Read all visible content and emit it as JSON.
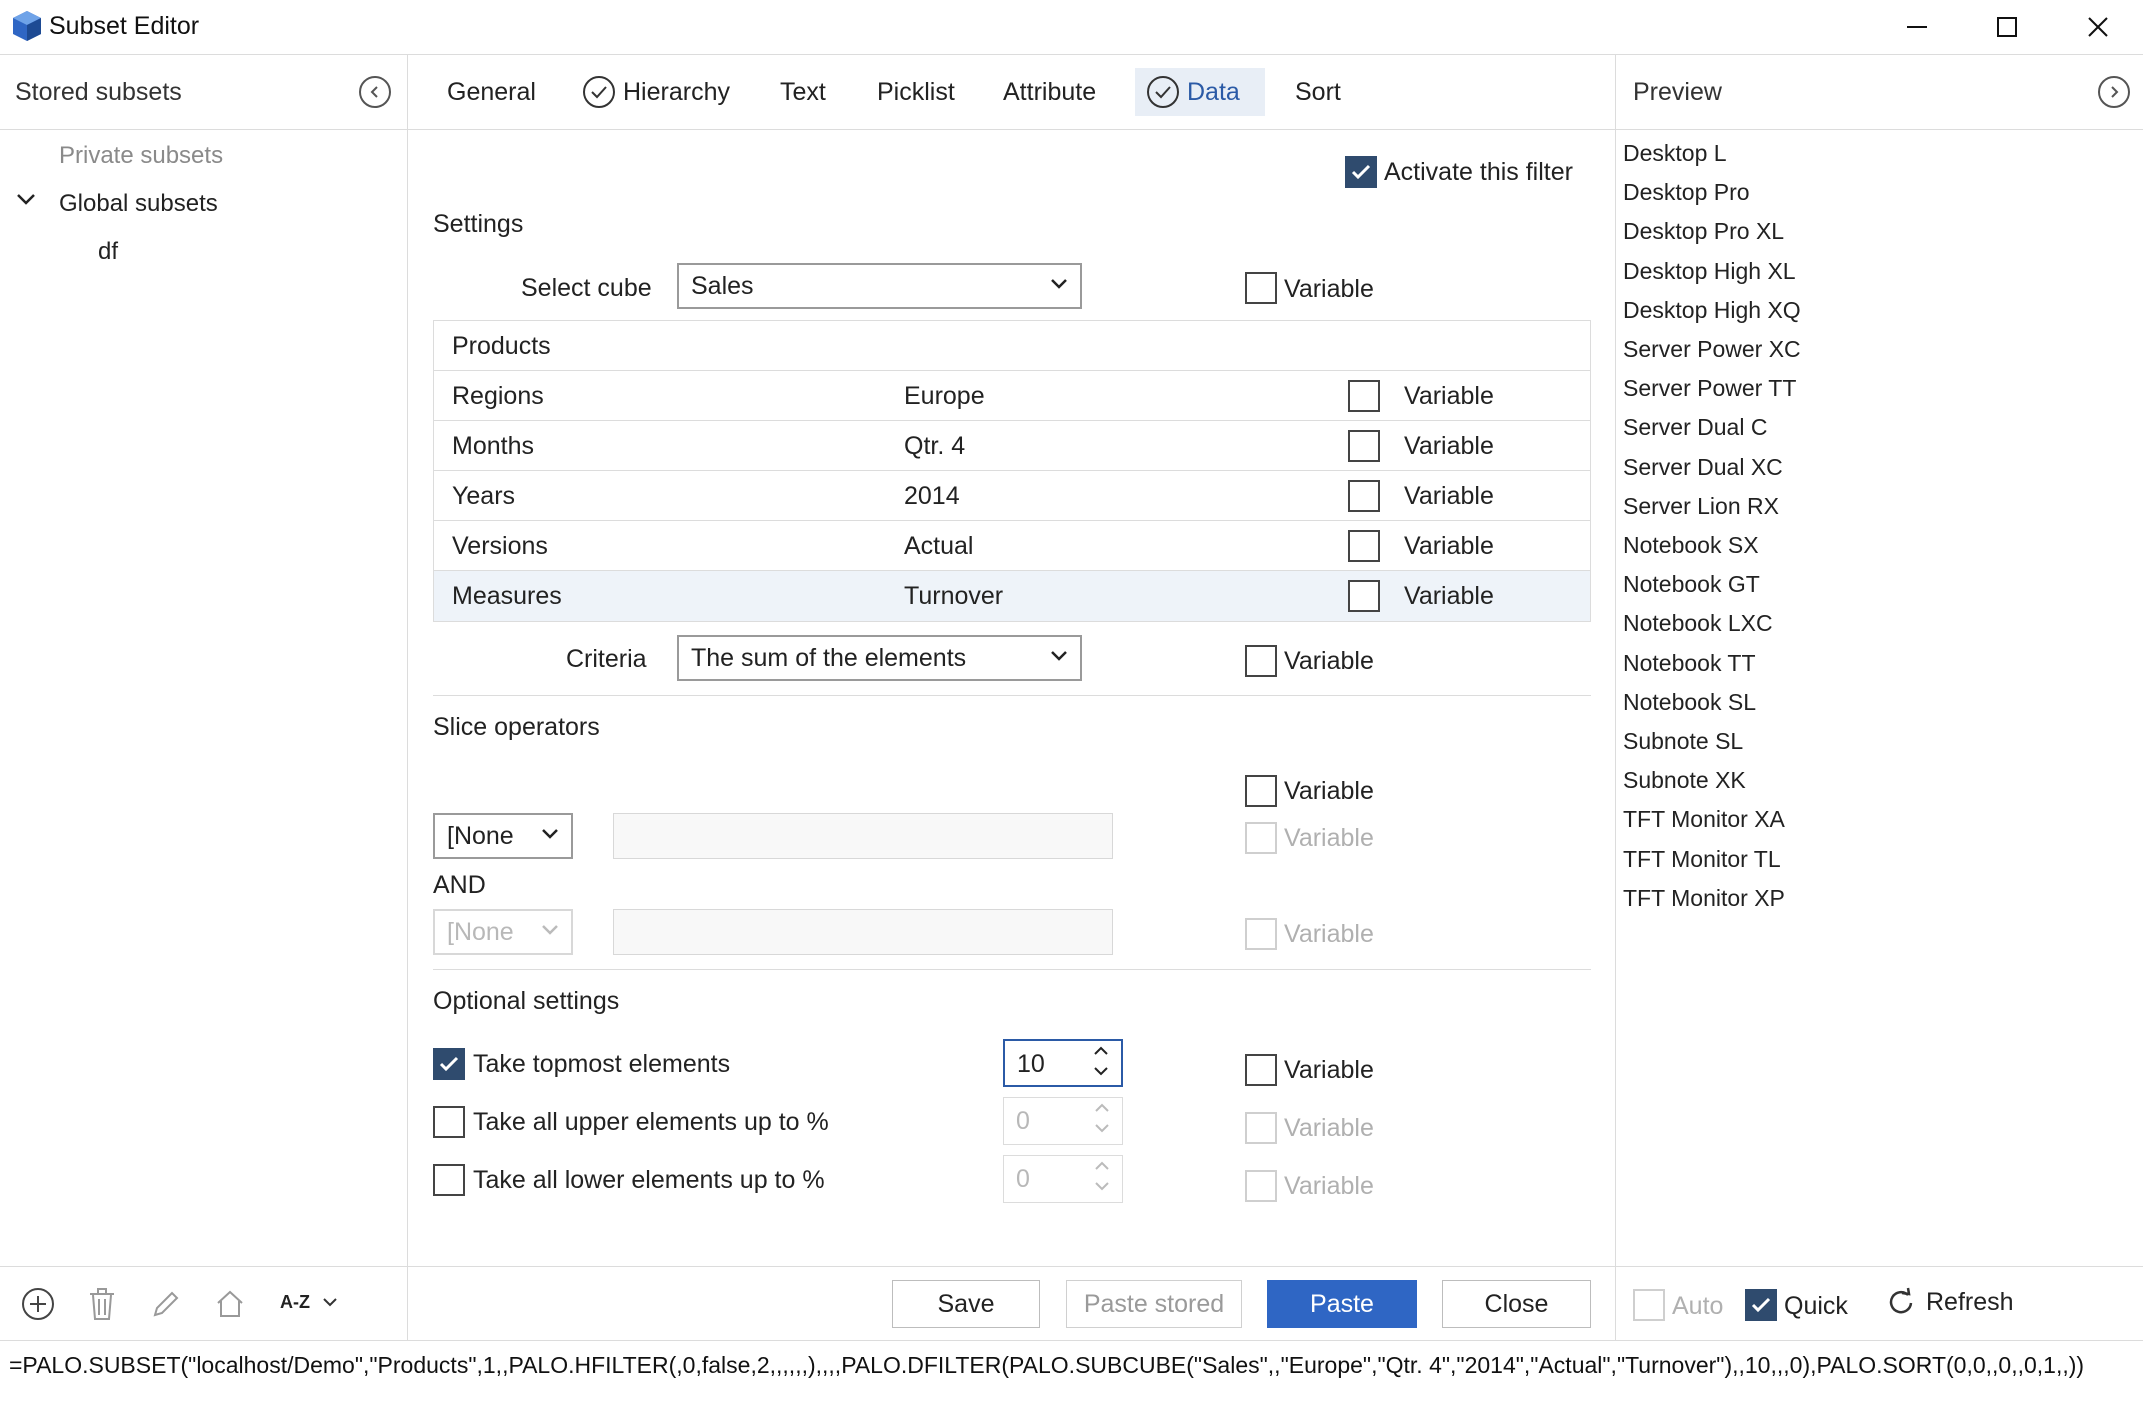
{
  "window": {
    "title": "Subset Editor"
  },
  "left_panel": {
    "title": "Stored subsets",
    "tree": [
      {
        "label": "Private subsets"
      },
      {
        "label": "Global subsets"
      },
      {
        "label": "df"
      }
    ],
    "sort_label": "A-Z"
  },
  "tabs": [
    {
      "label": "General"
    },
    {
      "label": "Hierarchy",
      "checked": true
    },
    {
      "label": "Text"
    },
    {
      "label": "Picklist"
    },
    {
      "label": "Attribute"
    },
    {
      "label": "Data",
      "checked": true,
      "active": true
    },
    {
      "label": "Sort"
    }
  ],
  "data_tab": {
    "activate_label": "Activate this filter",
    "settings_title": "Settings",
    "select_cube_label": "Select cube",
    "select_cube_value": "Sales",
    "variable_label": "Variable",
    "dimension_header": "Products",
    "dimensions": [
      {
        "name": "Regions",
        "value": "Europe"
      },
      {
        "name": "Months",
        "value": "Qtr. 4"
      },
      {
        "name": "Years",
        "value": "2014"
      },
      {
        "name": "Versions",
        "value": "Actual"
      },
      {
        "name": "Measures",
        "value": "Turnover"
      }
    ],
    "criteria_label": "Criteria",
    "criteria_value": "The sum of the elements",
    "slice_title": "Slice operators",
    "slice_op1": "[None",
    "and_label": "AND",
    "slice_op2": "[None",
    "optional_title": "Optional settings",
    "topmost_label": "Take topmost elements",
    "topmost_value": "10",
    "upper_label": "Take all upper elements up to %",
    "upper_value": "0",
    "lower_label": "Take all lower elements up to %",
    "lower_value": "0"
  },
  "buttons": {
    "save": "Save",
    "paste_stored": "Paste stored",
    "paste": "Paste",
    "close": "Close"
  },
  "preview": {
    "title": "Preview",
    "items": [
      "Desktop L",
      "Desktop Pro",
      "Desktop Pro XL",
      "Desktop High XL",
      "Desktop High XQ",
      "Server Power XC",
      "Server Power TT",
      "Server Dual C",
      "Server Dual XC",
      "Server Lion RX",
      "Notebook SX",
      "Notebook GT",
      "Notebook LXC",
      "Notebook TT",
      "Notebook SL",
      "Subnote SL",
      "Subnote XK",
      "TFT Monitor XA",
      "TFT Monitor TL",
      "TFT Monitor XP"
    ],
    "auto_label": "Auto",
    "quick_label": "Quick",
    "refresh_label": "Refresh"
  },
  "formula": "=PALO.SUBSET(\"localhost/Demo\",\"Products\",1,,PALO.HFILTER(,0,false,2,,,,,,),,,,PALO.DFILTER(PALO.SUBCUBE(\"Sales\",,\"Europe\",\"Qtr. 4\",\"2014\",\"Actual\",\"Turnover\"),,10,,,0),PALO.SORT(0,0,,0,,0,1,,))",
  "colors": {
    "accent": "#2f66c4",
    "checkbox_on": "#2f4b6e",
    "active_tab_bg": "#e8eef6"
  }
}
